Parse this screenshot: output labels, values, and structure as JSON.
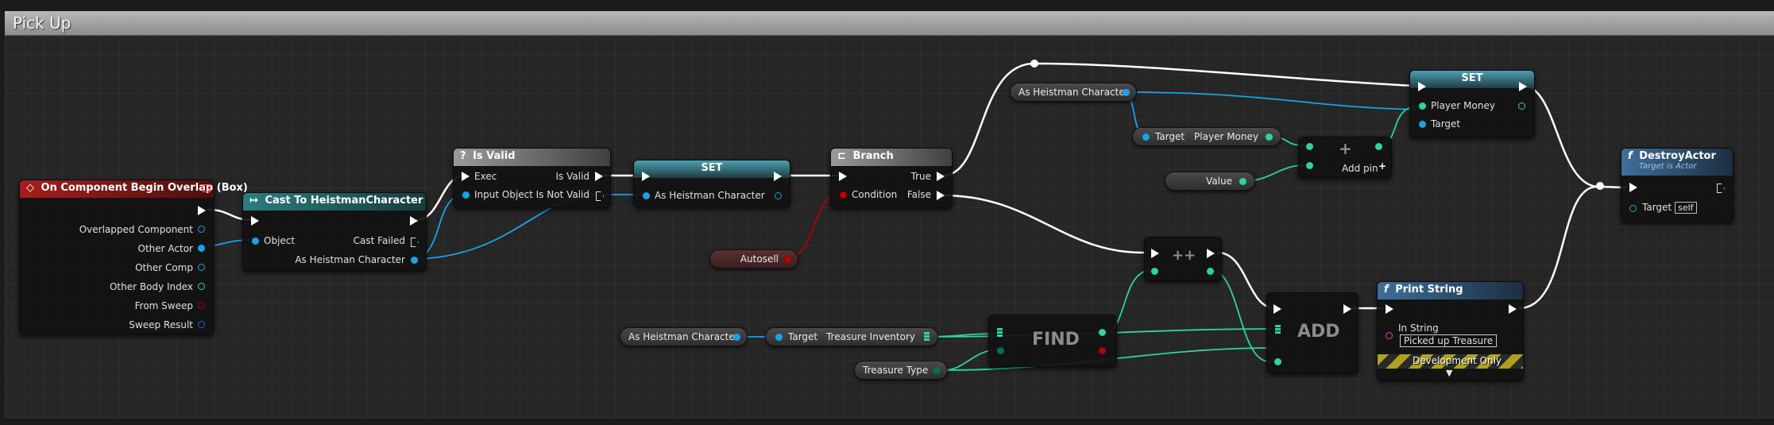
{
  "comment": {
    "title": "Pick Up"
  },
  "nodes": {
    "overlap": {
      "title": "On Component Begin Overlap (Box)",
      "pins": [
        "Overlapped Component",
        "Other Actor",
        "Other Comp",
        "Other Body Index",
        "From Sweep",
        "Sweep Result"
      ]
    },
    "cast": {
      "title": "Cast To HeistmanCharacter",
      "object": "Object",
      "cast_failed": "Cast Failed",
      "as_char": "As Heistman Character"
    },
    "isvalid": {
      "title": "Is Valid",
      "exec": "Exec",
      "is_valid": "Is Valid",
      "input_object": "Input Object",
      "is_not_valid": "Is Not Valid"
    },
    "set1": {
      "title": "SET",
      "pin": "As Heistman Character"
    },
    "branch": {
      "title": "Branch",
      "true": "True",
      "condition": "Condition",
      "false": "False"
    },
    "autosell": {
      "label": "Autosell"
    },
    "heist_var_top": {
      "label": "As Heistman Character"
    },
    "target_money": {
      "target": "Target",
      "money": "Player Money"
    },
    "value_var": {
      "label": "Value"
    },
    "add_float": {
      "glyph": "+",
      "add_pin": "Add pin"
    },
    "set2": {
      "title": "SET",
      "money": "Player Money",
      "target": "Target"
    },
    "destroy": {
      "title": "DestroyActor",
      "subtitle": "Target is Actor",
      "target": "Target",
      "self": "self"
    },
    "heist_var_bottom": {
      "label": "As Heistman Character"
    },
    "inventory": {
      "target": "Target",
      "inventory": "Treasure Inventory"
    },
    "treasure_type": {
      "label": "Treasure Type"
    },
    "find": {
      "label": "FIND"
    },
    "increment": {
      "glyph": "++"
    },
    "add_arr": {
      "label": "ADD"
    },
    "print": {
      "title": "Print String",
      "in_string": "In String",
      "value": "Picked up Treasure",
      "dev": "Development Only"
    }
  },
  "icons": {
    "event": "diamond-icon",
    "cast": "cast-arrow-icon",
    "isvalid": "question-icon",
    "branch": "branch-icon",
    "function": "function-icon"
  },
  "colors": {
    "exec": "#ffffff",
    "object": "#1aa3e8",
    "float": "#2fd3a0",
    "bool": "#b30000",
    "event_header": "#a51e1e",
    "cast_header": "#2b7d80",
    "function_header": "#3f6f9a"
  }
}
